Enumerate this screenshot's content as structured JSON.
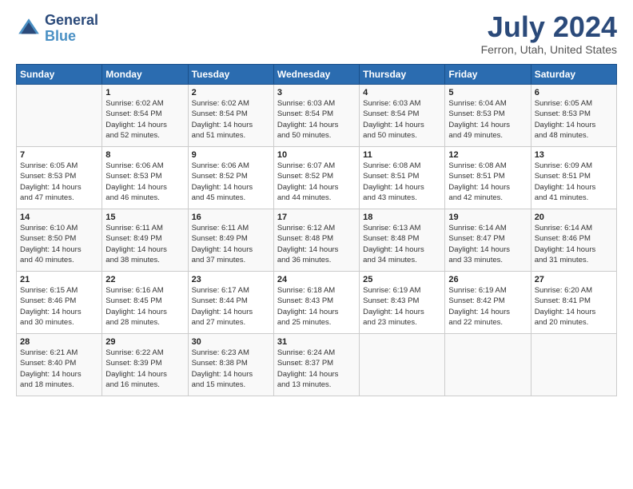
{
  "header": {
    "logo_line1": "General",
    "logo_line2": "Blue",
    "month": "July 2024",
    "location": "Ferron, Utah, United States"
  },
  "weekdays": [
    "Sunday",
    "Monday",
    "Tuesday",
    "Wednesday",
    "Thursday",
    "Friday",
    "Saturday"
  ],
  "weeks": [
    [
      {
        "day": "",
        "info": ""
      },
      {
        "day": "1",
        "info": "Sunrise: 6:02 AM\nSunset: 8:54 PM\nDaylight: 14 hours\nand 52 minutes."
      },
      {
        "day": "2",
        "info": "Sunrise: 6:02 AM\nSunset: 8:54 PM\nDaylight: 14 hours\nand 51 minutes."
      },
      {
        "day": "3",
        "info": "Sunrise: 6:03 AM\nSunset: 8:54 PM\nDaylight: 14 hours\nand 50 minutes."
      },
      {
        "day": "4",
        "info": "Sunrise: 6:03 AM\nSunset: 8:54 PM\nDaylight: 14 hours\nand 50 minutes."
      },
      {
        "day": "5",
        "info": "Sunrise: 6:04 AM\nSunset: 8:53 PM\nDaylight: 14 hours\nand 49 minutes."
      },
      {
        "day": "6",
        "info": "Sunrise: 6:05 AM\nSunset: 8:53 PM\nDaylight: 14 hours\nand 48 minutes."
      }
    ],
    [
      {
        "day": "7",
        "info": "Sunrise: 6:05 AM\nSunset: 8:53 PM\nDaylight: 14 hours\nand 47 minutes."
      },
      {
        "day": "8",
        "info": "Sunrise: 6:06 AM\nSunset: 8:53 PM\nDaylight: 14 hours\nand 46 minutes."
      },
      {
        "day": "9",
        "info": "Sunrise: 6:06 AM\nSunset: 8:52 PM\nDaylight: 14 hours\nand 45 minutes."
      },
      {
        "day": "10",
        "info": "Sunrise: 6:07 AM\nSunset: 8:52 PM\nDaylight: 14 hours\nand 44 minutes."
      },
      {
        "day": "11",
        "info": "Sunrise: 6:08 AM\nSunset: 8:51 PM\nDaylight: 14 hours\nand 43 minutes."
      },
      {
        "day": "12",
        "info": "Sunrise: 6:08 AM\nSunset: 8:51 PM\nDaylight: 14 hours\nand 42 minutes."
      },
      {
        "day": "13",
        "info": "Sunrise: 6:09 AM\nSunset: 8:51 PM\nDaylight: 14 hours\nand 41 minutes."
      }
    ],
    [
      {
        "day": "14",
        "info": "Sunrise: 6:10 AM\nSunset: 8:50 PM\nDaylight: 14 hours\nand 40 minutes."
      },
      {
        "day": "15",
        "info": "Sunrise: 6:11 AM\nSunset: 8:49 PM\nDaylight: 14 hours\nand 38 minutes."
      },
      {
        "day": "16",
        "info": "Sunrise: 6:11 AM\nSunset: 8:49 PM\nDaylight: 14 hours\nand 37 minutes."
      },
      {
        "day": "17",
        "info": "Sunrise: 6:12 AM\nSunset: 8:48 PM\nDaylight: 14 hours\nand 36 minutes."
      },
      {
        "day": "18",
        "info": "Sunrise: 6:13 AM\nSunset: 8:48 PM\nDaylight: 14 hours\nand 34 minutes."
      },
      {
        "day": "19",
        "info": "Sunrise: 6:14 AM\nSunset: 8:47 PM\nDaylight: 14 hours\nand 33 minutes."
      },
      {
        "day": "20",
        "info": "Sunrise: 6:14 AM\nSunset: 8:46 PM\nDaylight: 14 hours\nand 31 minutes."
      }
    ],
    [
      {
        "day": "21",
        "info": "Sunrise: 6:15 AM\nSunset: 8:46 PM\nDaylight: 14 hours\nand 30 minutes."
      },
      {
        "day": "22",
        "info": "Sunrise: 6:16 AM\nSunset: 8:45 PM\nDaylight: 14 hours\nand 28 minutes."
      },
      {
        "day": "23",
        "info": "Sunrise: 6:17 AM\nSunset: 8:44 PM\nDaylight: 14 hours\nand 27 minutes."
      },
      {
        "day": "24",
        "info": "Sunrise: 6:18 AM\nSunset: 8:43 PM\nDaylight: 14 hours\nand 25 minutes."
      },
      {
        "day": "25",
        "info": "Sunrise: 6:19 AM\nSunset: 8:43 PM\nDaylight: 14 hours\nand 23 minutes."
      },
      {
        "day": "26",
        "info": "Sunrise: 6:19 AM\nSunset: 8:42 PM\nDaylight: 14 hours\nand 22 minutes."
      },
      {
        "day": "27",
        "info": "Sunrise: 6:20 AM\nSunset: 8:41 PM\nDaylight: 14 hours\nand 20 minutes."
      }
    ],
    [
      {
        "day": "28",
        "info": "Sunrise: 6:21 AM\nSunset: 8:40 PM\nDaylight: 14 hours\nand 18 minutes."
      },
      {
        "day": "29",
        "info": "Sunrise: 6:22 AM\nSunset: 8:39 PM\nDaylight: 14 hours\nand 16 minutes."
      },
      {
        "day": "30",
        "info": "Sunrise: 6:23 AM\nSunset: 8:38 PM\nDaylight: 14 hours\nand 15 minutes."
      },
      {
        "day": "31",
        "info": "Sunrise: 6:24 AM\nSunset: 8:37 PM\nDaylight: 14 hours\nand 13 minutes."
      },
      {
        "day": "",
        "info": ""
      },
      {
        "day": "",
        "info": ""
      },
      {
        "day": "",
        "info": ""
      }
    ]
  ]
}
